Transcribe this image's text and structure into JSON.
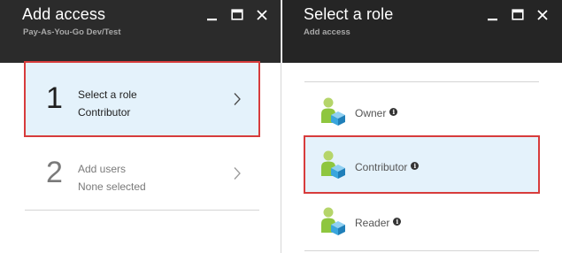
{
  "colors": {
    "header_bg": "#2b2b2b",
    "selected_bg": "#e4f2fb",
    "highlight_border": "#d73c3c",
    "role_icon_green": "#8ec63f",
    "role_icon_blue": "#3aa6dd"
  },
  "left_blade": {
    "title": "Add access",
    "subtitle": "Pay-As-You-Go Dev/Test",
    "controls": [
      "minimize-icon",
      "maximize-icon",
      "close-icon"
    ],
    "steps": [
      {
        "number": "1",
        "title": "Select a role",
        "value": "Contributor",
        "state": "selected"
      },
      {
        "number": "2",
        "title": "Add users",
        "value": "None selected",
        "state": "inactive"
      }
    ]
  },
  "right_blade": {
    "title": "Select a role",
    "subtitle": "Add access",
    "controls": [
      "minimize-icon",
      "maximize-icon",
      "close-icon"
    ],
    "roles": [
      {
        "name": "Owner",
        "icon": "role-user-icon",
        "info": "i",
        "selected": false
      },
      {
        "name": "Contributor",
        "icon": "role-user-icon",
        "info": "i",
        "selected": true
      },
      {
        "name": "Reader",
        "icon": "role-user-icon",
        "info": "i",
        "selected": false
      }
    ]
  }
}
